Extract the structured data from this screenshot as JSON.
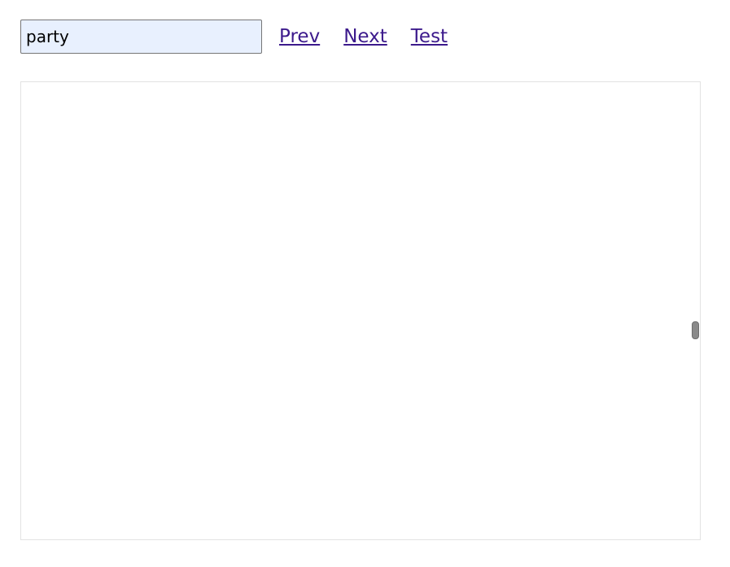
{
  "search": {
    "value": "party"
  },
  "nav": {
    "prev_label": "Prev",
    "next_label": "Next",
    "test_label": "Test",
    "link_color": "#3c1a8c"
  },
  "content": {
    "scroll_position": 0.5
  }
}
